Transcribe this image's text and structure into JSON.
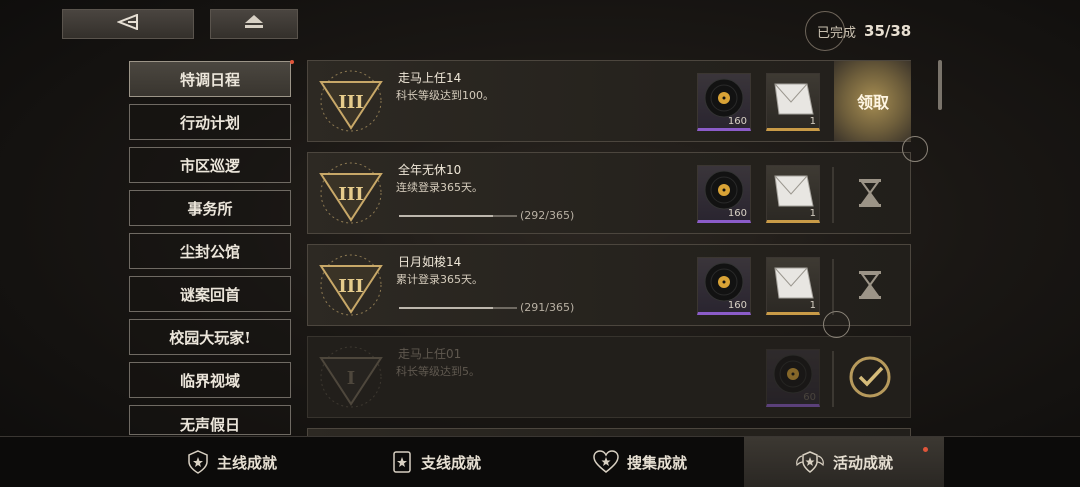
{
  "header": {
    "back_icon": "back-arrow-icon",
    "home_icon": "eject-home-icon",
    "completed_label": "已完成",
    "completed_count": "35/38"
  },
  "sidebar": {
    "items": [
      {
        "label": "特调日程",
        "active": true,
        "has_notice": true
      },
      {
        "label": "行动计划"
      },
      {
        "label": "市区巡逻"
      },
      {
        "label": "事务所"
      },
      {
        "label": "尘封公馆"
      },
      {
        "label": "谜案回首"
      },
      {
        "label": "校园大玩家!"
      },
      {
        "label": "临界视域"
      },
      {
        "label": "无声假日"
      }
    ]
  },
  "achievements": [
    {
      "title": "走马上任14",
      "desc": "科长等级达到100。",
      "status": "claimable",
      "claim_label": "领取",
      "rewards": [
        {
          "icon": "vinyl-record-icon",
          "rarity": "purple",
          "qty": "160"
        },
        {
          "icon": "paper-ticket-icon",
          "rarity": "gold",
          "qty": "1"
        }
      ]
    },
    {
      "title": "全年无休10",
      "desc": "连续登录365天。",
      "status": "in-progress",
      "progress_text": "(292/365)",
      "progress": 0.8,
      "rewards": [
        {
          "icon": "vinyl-record-icon",
          "rarity": "purple",
          "qty": "160"
        },
        {
          "icon": "paper-ticket-icon",
          "rarity": "gold",
          "qty": "1"
        }
      ]
    },
    {
      "title": "日月如梭14",
      "desc": "累计登录365天。",
      "status": "in-progress",
      "progress_text": "(291/365)",
      "progress": 0.797,
      "rewards": [
        {
          "icon": "vinyl-record-icon",
          "rarity": "purple",
          "qty": "160"
        },
        {
          "icon": "paper-ticket-icon",
          "rarity": "gold",
          "qty": "1"
        }
      ]
    },
    {
      "title": "走马上任01",
      "desc": "科长等级达到5。",
      "status": "completed",
      "rewards": [
        {
          "icon": "vinyl-record-icon",
          "rarity": "purple",
          "qty": "60"
        }
      ]
    }
  ],
  "tabs": [
    {
      "label": "主线成就",
      "icon": "shield-star-icon"
    },
    {
      "label": "支线成就",
      "icon": "shield-star-icon"
    },
    {
      "label": "搜集成就",
      "icon": "heart-shield-icon"
    },
    {
      "label": "活动成就",
      "icon": "winged-shield-icon",
      "active": true,
      "has_notice": true
    }
  ],
  "colors": {
    "accent_gold": "#c99b47",
    "rarity_purple": "#8b5cc9",
    "notice_red": "#e0553a"
  }
}
